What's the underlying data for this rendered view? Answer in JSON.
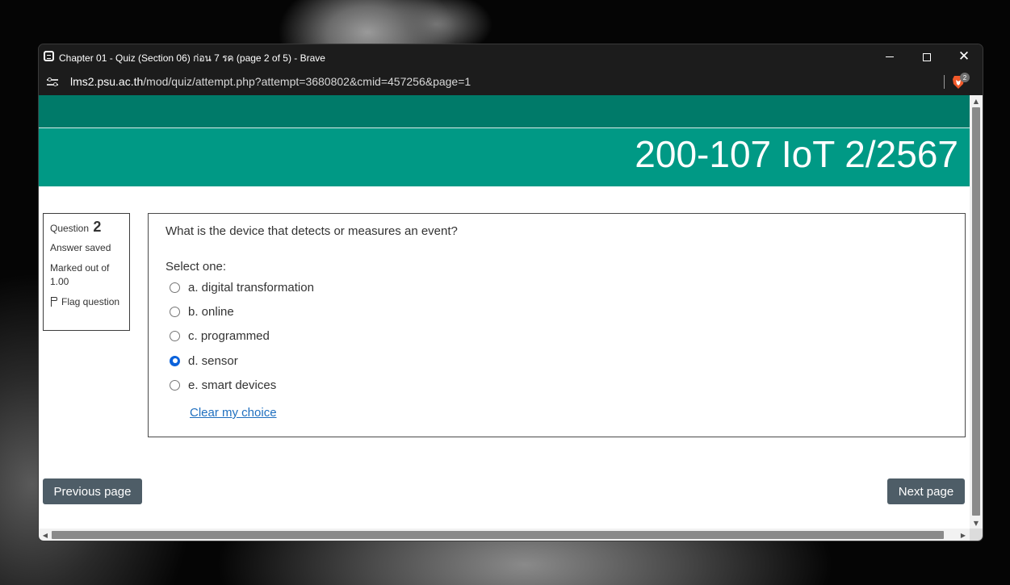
{
  "window": {
    "title": "Chapter 01 - Quiz (Section 06) ก่อน 7 รค (page 2 of 5) - Brave"
  },
  "address_bar": {
    "host": "lms2.psu.ac.th",
    "path": "/mod/quiz/attempt.php?attempt=3680802&cmid=457256&page=1",
    "brave_badge_count": "2"
  },
  "course": {
    "title": "200-107 IoT 2/2567"
  },
  "question_info": {
    "label": "Question",
    "number": "2",
    "state": "Answer saved",
    "grade": "Marked out of 1.00",
    "flag_label": "Flag question"
  },
  "question": {
    "text": "What is the device that detects or measures an event?",
    "prompt": "Select one:",
    "options": [
      {
        "label": "a. digital transformation",
        "selected": false
      },
      {
        "label": "b. online",
        "selected": false
      },
      {
        "label": "c. programmed",
        "selected": false
      },
      {
        "label": "d. sensor",
        "selected": true
      },
      {
        "label": "e. smart devices",
        "selected": false
      }
    ],
    "clear_label": "Clear my choice"
  },
  "navigation": {
    "previous_label": "Previous page",
    "next_label": "Next page"
  },
  "colors": {
    "nav_band": "#007a69",
    "banner": "#009985",
    "button": "#4e5d67",
    "link": "#1f6fbf",
    "radio_selected": "#0b62db"
  }
}
